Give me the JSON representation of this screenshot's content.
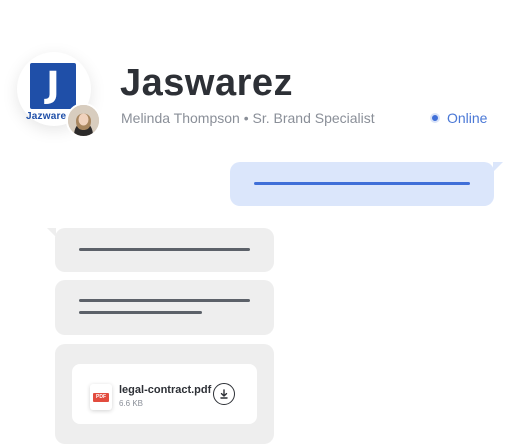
{
  "header": {
    "logo_glyph": "J",
    "logo_text": "Jazwares",
    "company_name": "Jaswarez",
    "contact_line": "Melinda Thompson • Sr. Brand Specialist",
    "status": "Online"
  },
  "messages": [
    {
      "direction": "outgoing",
      "kind": "text-placeholder"
    },
    {
      "direction": "incoming",
      "kind": "text-placeholder"
    },
    {
      "direction": "incoming",
      "kind": "text-placeholder"
    },
    {
      "direction": "incoming",
      "kind": "file",
      "file": {
        "type_badge": "PDF",
        "name": "legal-contract.pdf",
        "size": "6.6 KB",
        "action_icon": "download-icon"
      }
    }
  ],
  "colors": {
    "brand_blue": "#1f4fa8",
    "accent": "#3f6fd8",
    "outgoing_bubble": "#dbe6fb",
    "incoming_bubble": "#eeeeee",
    "pdf_red": "#e24c3f"
  }
}
